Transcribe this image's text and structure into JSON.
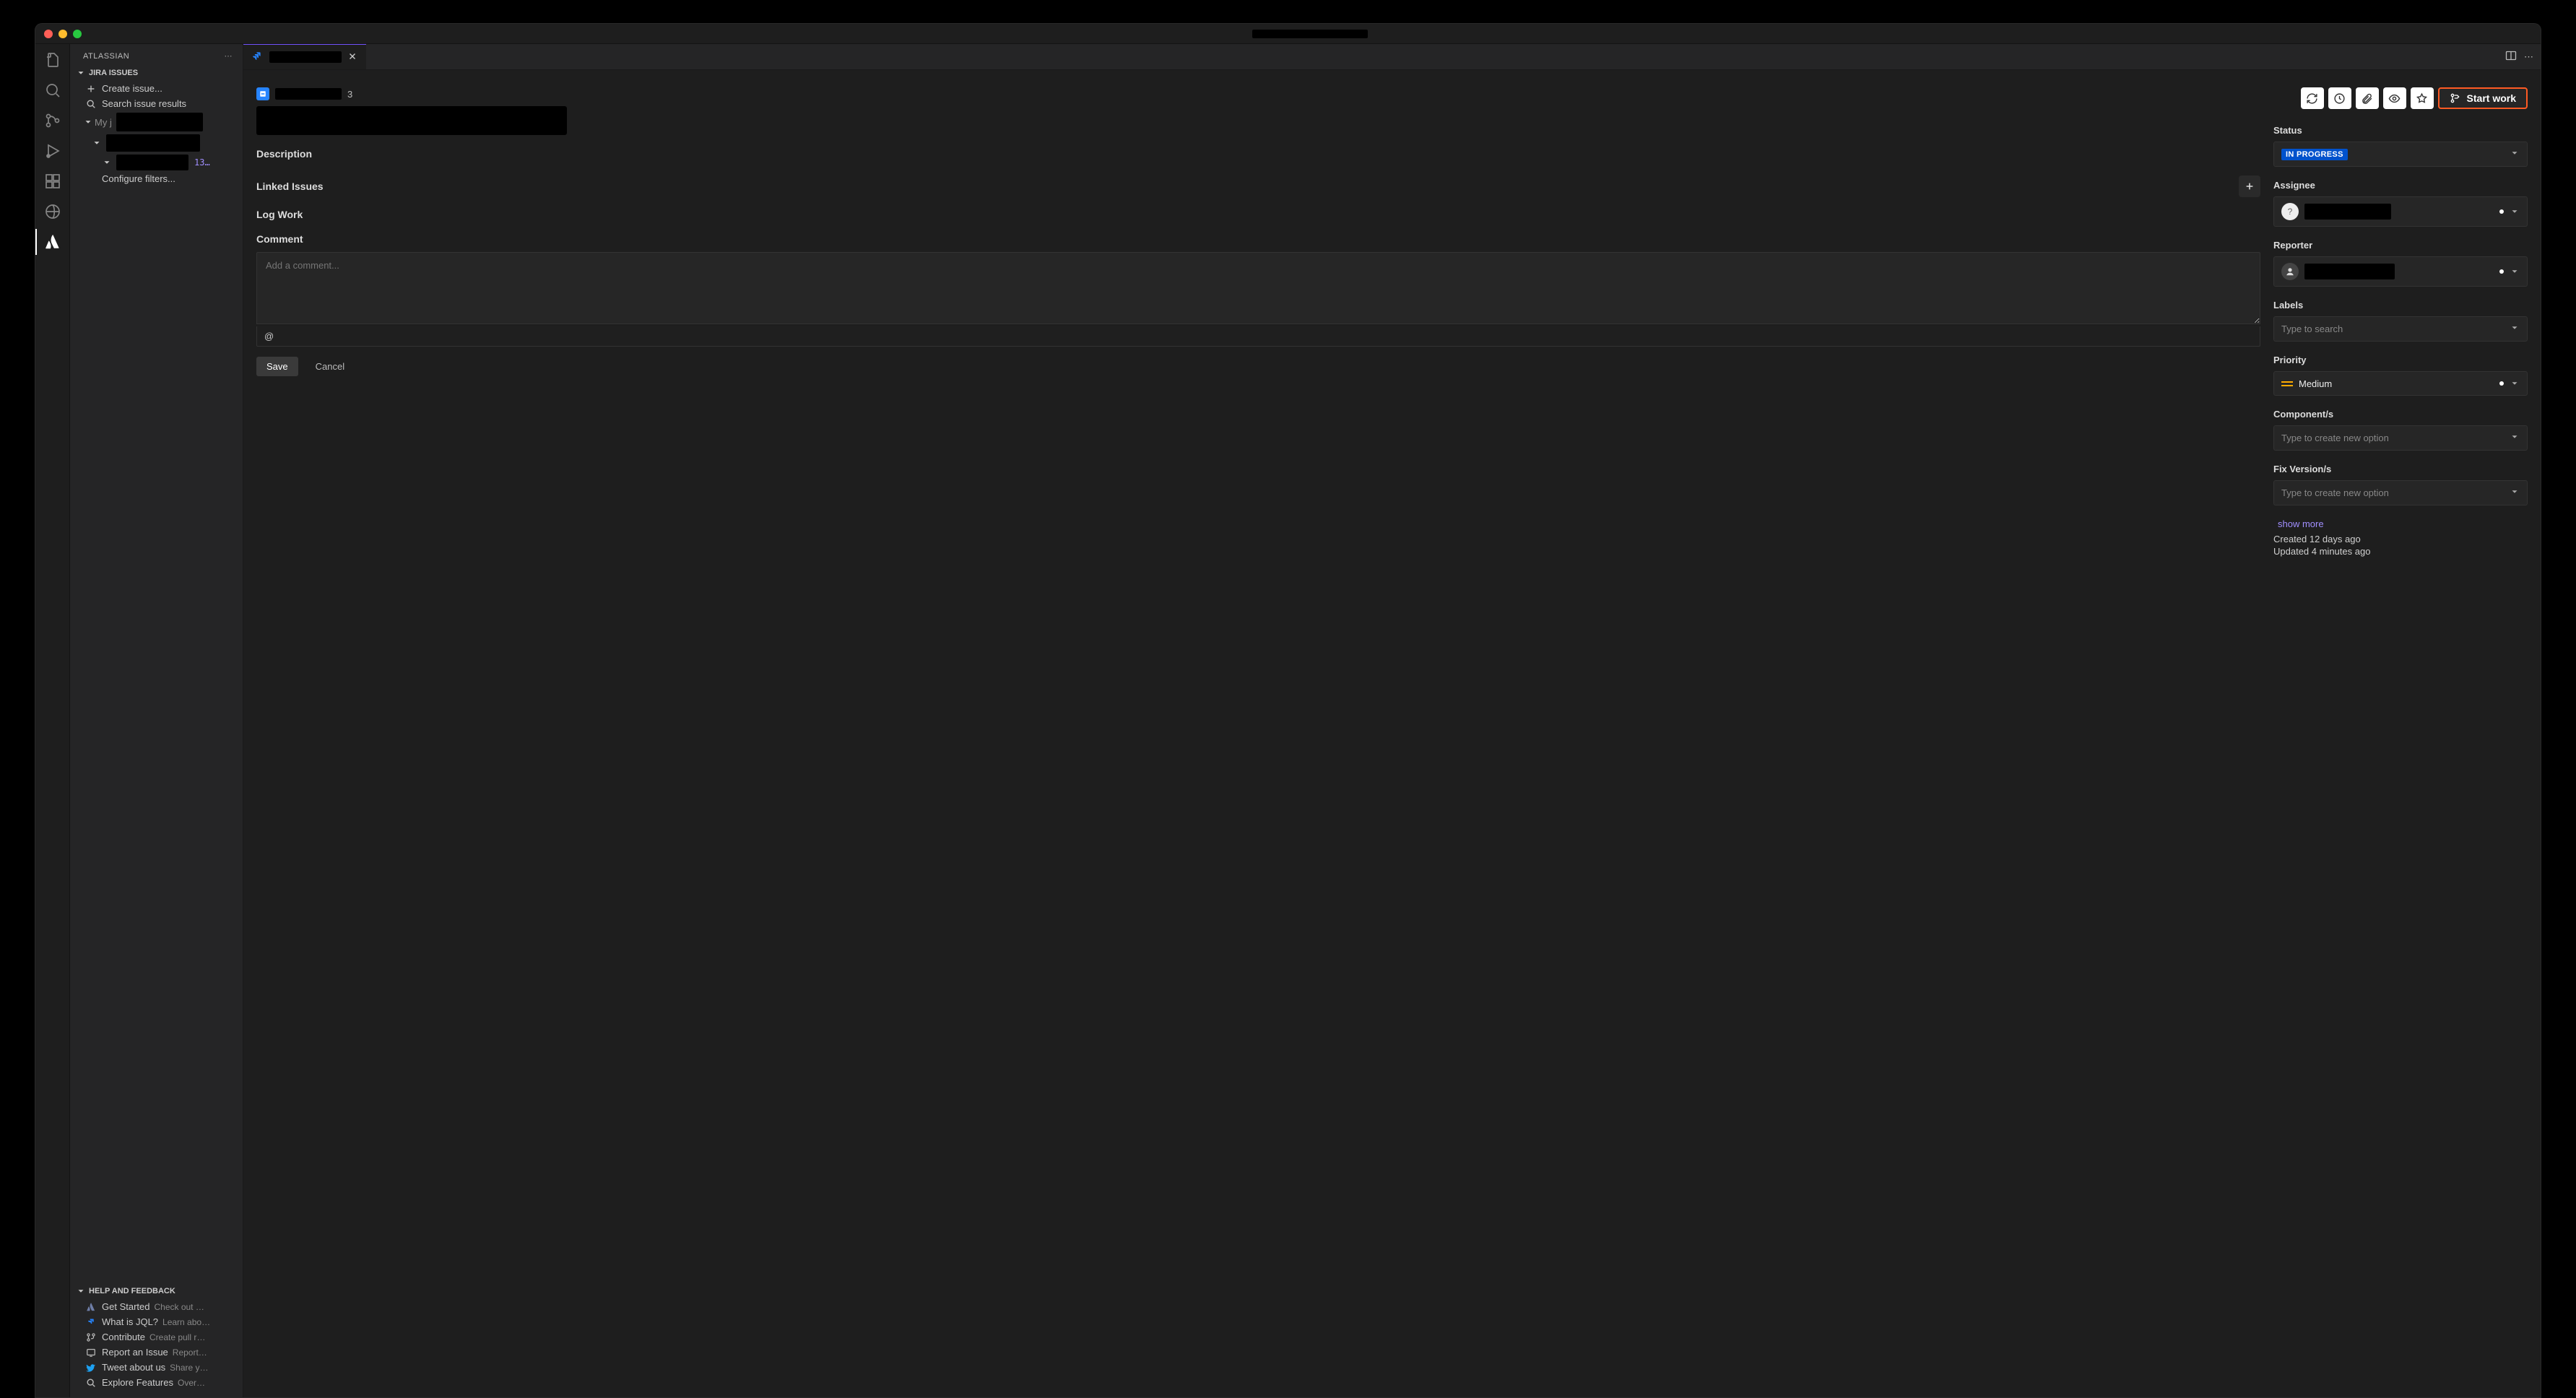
{
  "sidebar": {
    "title": "ATLASSIAN",
    "sections": {
      "jira": {
        "title": "JIRA ISSUES",
        "create": "Create issue...",
        "search": "Search issue results",
        "myj": "My j",
        "issue_num": "13…",
        "configure": "Configure filters..."
      },
      "help": {
        "title": "HELP AND FEEDBACK",
        "items": [
          {
            "icon": "atlassian",
            "primary": "Get Started",
            "secondary": "Check out …"
          },
          {
            "icon": "jira",
            "primary": "What is JQL?",
            "secondary": "Learn abo…"
          },
          {
            "icon": "pull",
            "primary": "Contribute",
            "secondary": "Create pull r…"
          },
          {
            "icon": "report",
            "primary": "Report an Issue",
            "secondary": "Report…"
          },
          {
            "icon": "twitter",
            "primary": "Tweet about us",
            "secondary": "Share y…"
          },
          {
            "icon": "search",
            "primary": "Explore Features",
            "secondary": "Over…"
          }
        ]
      }
    }
  },
  "tab": {
    "issue_key_suffix": "3"
  },
  "issue": {
    "description_h": "Description",
    "linked_h": "Linked Issues",
    "logwork_h": "Log Work",
    "comment_h": "Comment",
    "comment_placeholder": "Add a comment...",
    "mention_symbol": "@",
    "save": "Save",
    "cancel": "Cancel"
  },
  "actions": {
    "start_work": "Start work"
  },
  "details": {
    "status_label": "Status",
    "status_value": "IN PROGRESS",
    "assignee_label": "Assignee",
    "reporter_label": "Reporter",
    "labels_label": "Labels",
    "labels_placeholder": "Type to search",
    "priority_label": "Priority",
    "priority_value": "Medium",
    "components_label": "Component/s",
    "components_placeholder": "Type to create new option",
    "fixversion_label": "Fix Version/s",
    "fixversion_placeholder": "Type to create new option",
    "show_more": "show more",
    "created": "Created 12 days ago",
    "updated": "Updated 4 minutes ago"
  }
}
